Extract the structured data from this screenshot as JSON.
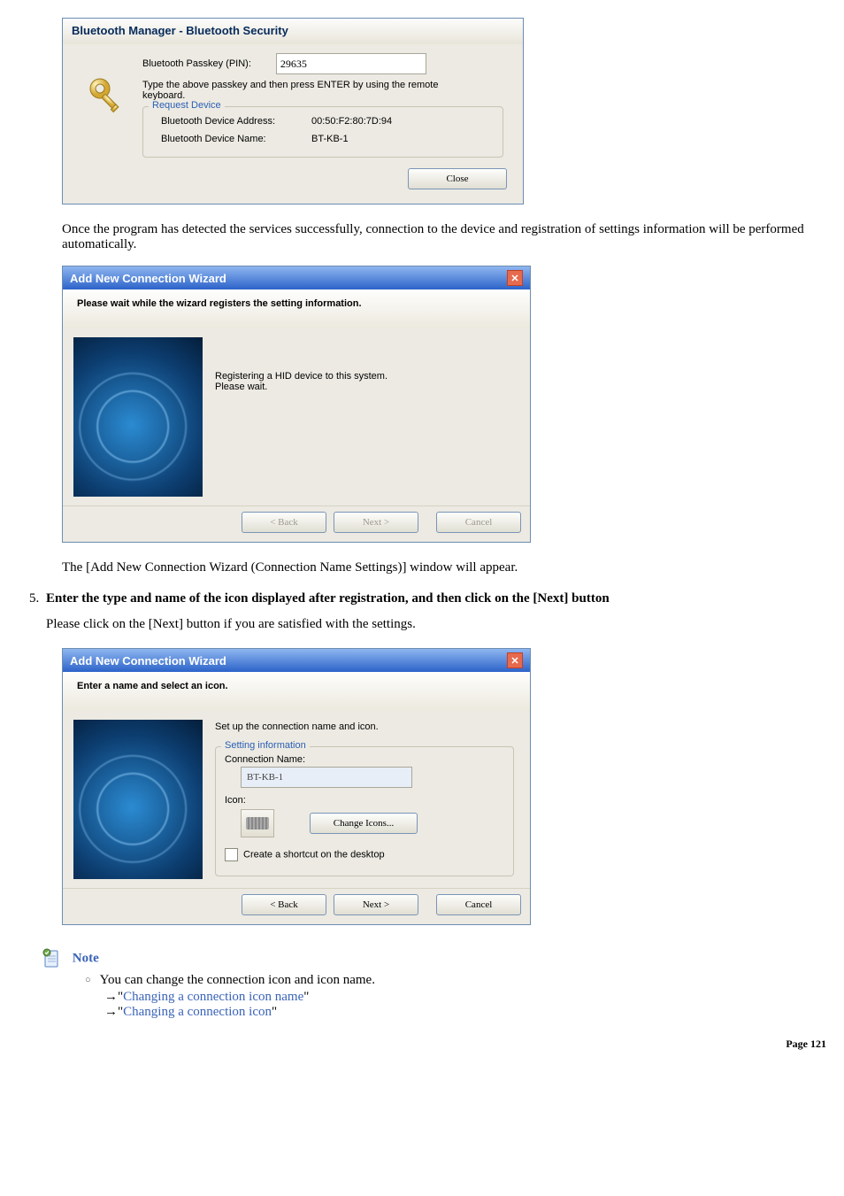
{
  "dialog1": {
    "title": "Bluetooth Manager - Bluetooth Security",
    "passkey_label": "Bluetooth Passkey (PIN):",
    "passkey_value": "29635",
    "instruction": "Type the above passkey and then press ENTER by using the remote keyboard.",
    "group_title": "Request Device",
    "addr_label": "Bluetooth Device Address:",
    "addr_value": "00:50:F2:80:7D:94",
    "name_label": "Bluetooth Device Name:",
    "name_value": "BT-KB-1",
    "close": "Close"
  },
  "para1": "Once the program has detected the services successfully, connection to the device and registration of settings information will be performed automatically.",
  "dialog2": {
    "title": "Add New Connection Wizard",
    "subtitle": "Please wait while the wizard registers the setting information.",
    "msg1": "Registering a HID device to this system.",
    "msg2": "Please wait.",
    "back": "< Back",
    "next": "Next >",
    "cancel": "Cancel"
  },
  "para2": "The [Add New Connection Wizard (Connection Name Settings)] window will appear.",
  "step5": {
    "title": "Enter the type and name of the icon displayed after registration, and then click on the [Next] button",
    "para": "Please click on the [Next] button if you are satisfied with the settings."
  },
  "dialog3": {
    "title": "Add New Connection Wizard",
    "subtitle": "Enter a name and select an icon.",
    "setup_label": "Set up the connection name and icon.",
    "group_title": "Setting information",
    "conn_name_label": "Connection Name:",
    "conn_name_value": "BT-KB-1",
    "icon_label": "Icon:",
    "change_icons": "Change Icons...",
    "shortcut": "Create a shortcut on the desktop",
    "back": "< Back",
    "next": "Next >",
    "cancel": "Cancel"
  },
  "note": {
    "label": "Note",
    "bullet": "You can change the connection icon and icon name.",
    "link1": "Changing a connection icon name",
    "link2": "Changing a connection icon",
    "arrow": "→\"",
    "endq": "\""
  },
  "page": "Page 121"
}
